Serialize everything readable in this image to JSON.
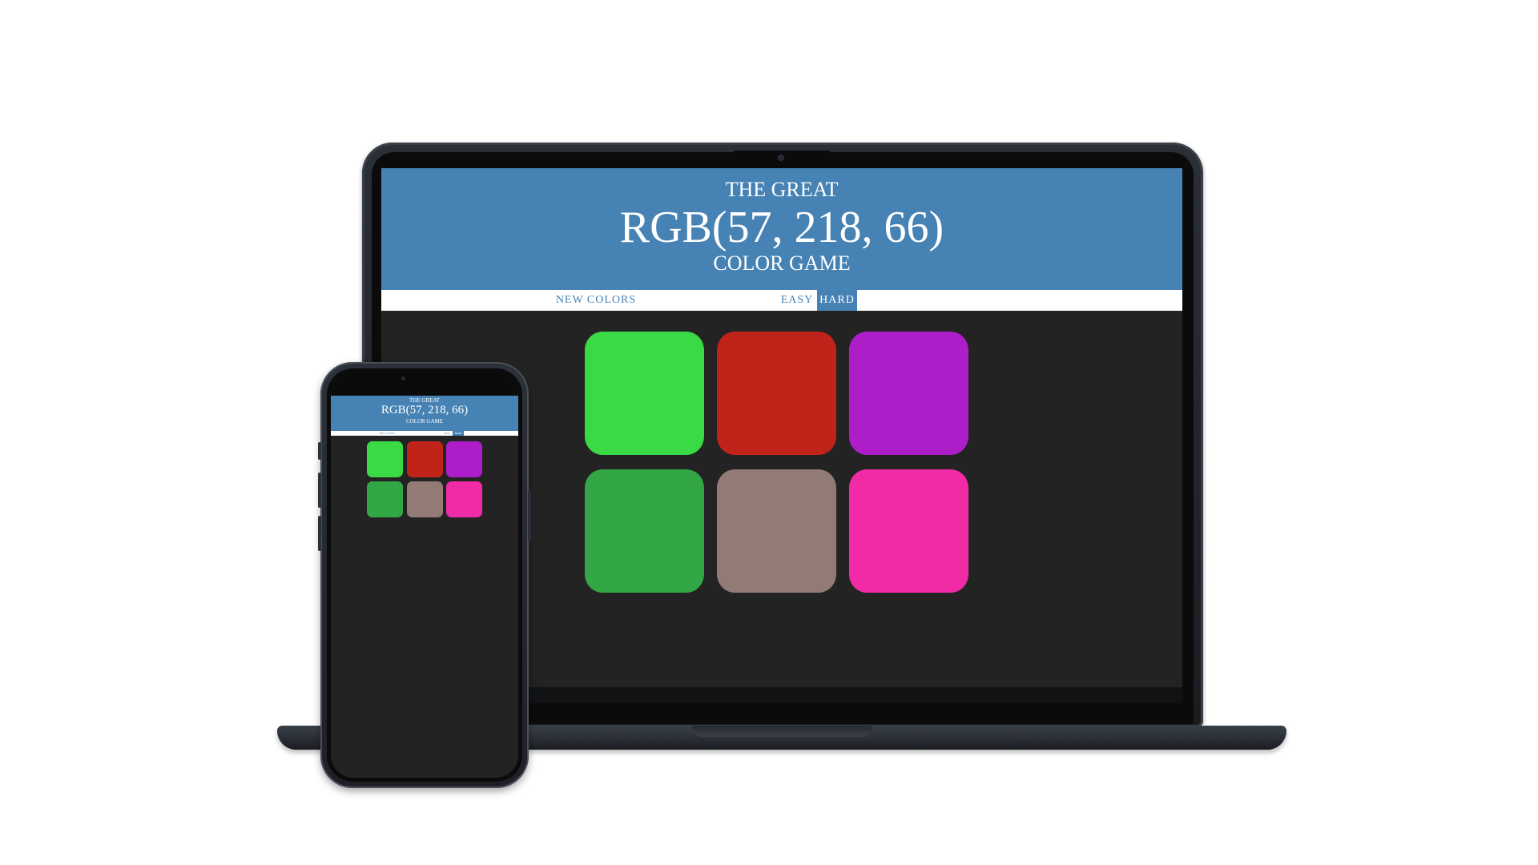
{
  "game": {
    "title_top": "THE GREAT",
    "target_color": "RGB(57, 218, 66)",
    "title_bottom": "COLOR GAME",
    "nav": {
      "new_colors": "NEW COLORS",
      "easy": "EASY",
      "hard": "HARD",
      "selected_mode": "HARD"
    },
    "squares": [
      {
        "color": "#3ada47"
      },
      {
        "color": "#c02319"
      },
      {
        "color": "#ad1ec8"
      },
      {
        "color": "#33a646"
      },
      {
        "color": "#917b74"
      },
      {
        "color": "#f12ba5"
      }
    ]
  },
  "colors": {
    "header": "#4682b4",
    "body": "#232323",
    "nav_bg": "#ffffff",
    "accent": "#4682b4"
  }
}
